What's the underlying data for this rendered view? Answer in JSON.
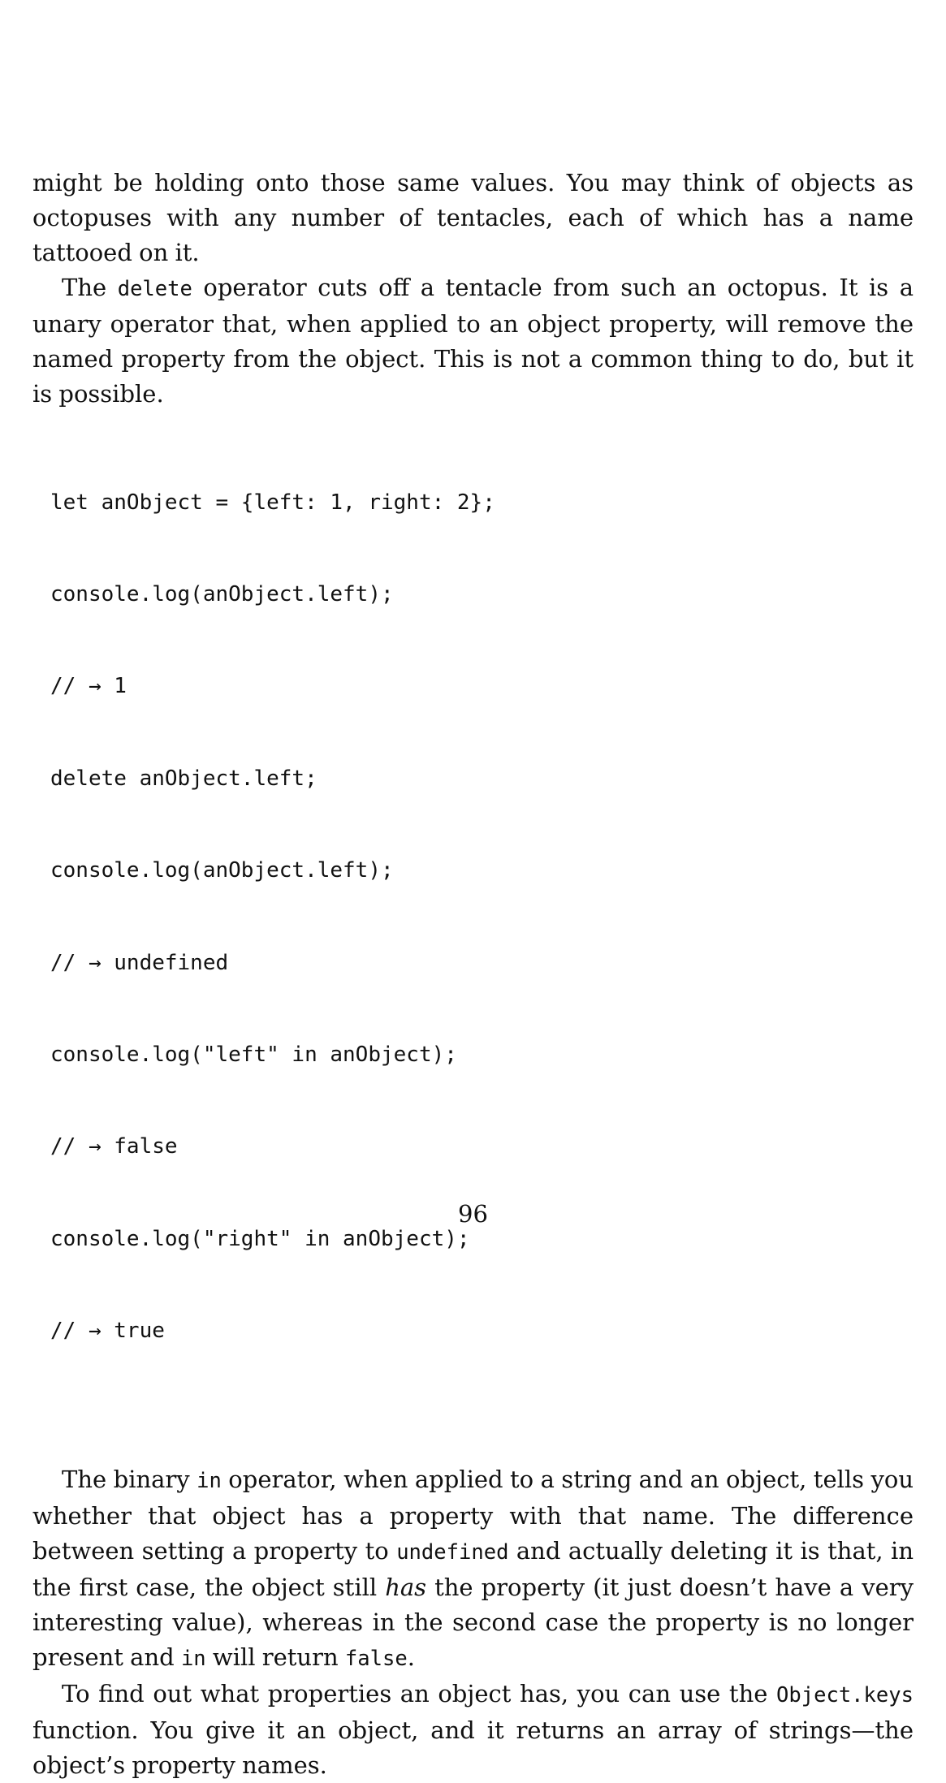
{
  "paragraphs": {
    "p1": {
      "text": "might be holding onto those same values. You may think of objects as octopuses with any number of tentacles, each of which has a name tattooed on it."
    },
    "p2": {
      "t1": "The ",
      "c1": "delete",
      "t2": " operator cuts off a tentacle from such an octopus. It is a unary operator that, when applied to an object property, will remove the named property from the object. This is not a common thing to do, but it is possible."
    },
    "p3": {
      "t1": "The binary ",
      "c1": "in",
      "t2": " operator, when applied to a string and an object, tells you whether that object has a property with that name. The difference between setting a property to ",
      "c2": "undefined",
      "t3": " and actually deleting it is that, in the first case, the object still ",
      "em1": "has",
      "t4": " the property (it just doesn’t have a very interesting value), whereas in the second case the property is no longer present and ",
      "c3": "in",
      "t5": " will return ",
      "c4": "false",
      "t6": "."
    },
    "p4": {
      "t1": "To find out what properties an object has, you can use the ",
      "c1": "Object.keys",
      "t2": " function. You give it an object, and it returns an array of strings—the object’s property names."
    }
  },
  "code_lines": [
    "let anObject = {left: 1, right: 2};",
    "console.log(anObject.left);",
    "// → 1",
    "delete anObject.left;",
    "console.log(anObject.left);",
    "// → undefined",
    "console.log(\"left\" in anObject);",
    "// → false",
    "console.log(\"right\" in anObject);",
    "// → true"
  ],
  "page_number": "96"
}
